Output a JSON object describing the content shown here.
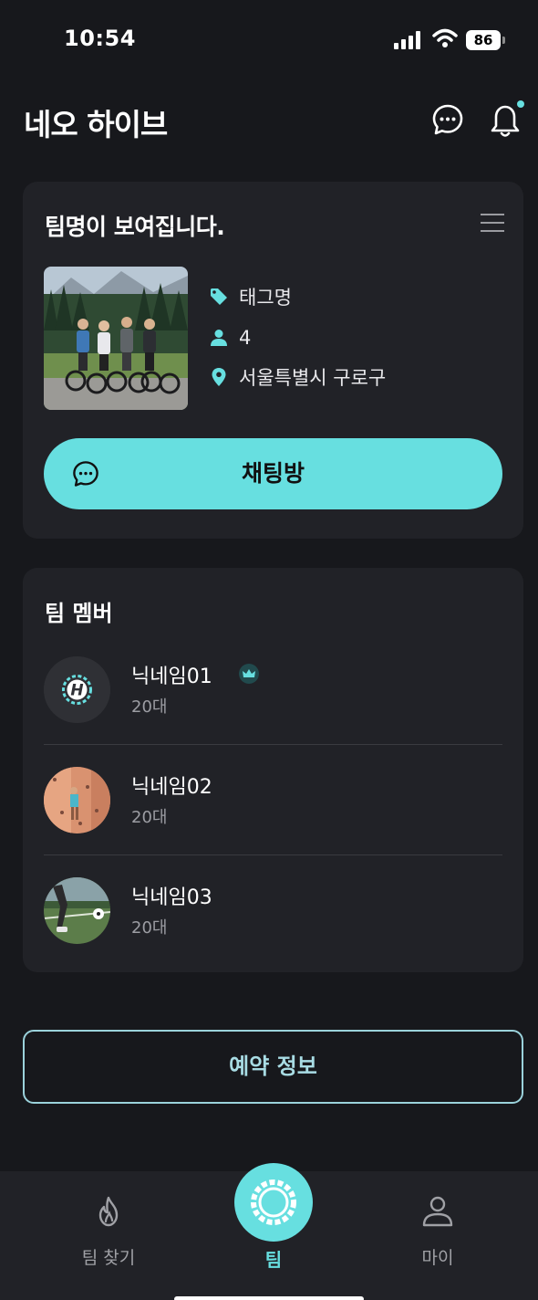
{
  "status_bar": {
    "time": "10:54",
    "battery": "86"
  },
  "header": {
    "title": "네오 하이브",
    "chat_icon": "chat-bubble-icon",
    "bell_icon": "bell-icon"
  },
  "team": {
    "name": "팀명이 보여집니다.",
    "tag": "태그명",
    "member_count": "4",
    "location": "서울특별시 구로구",
    "chat_button": "채팅방"
  },
  "members": {
    "title": "팀 멤버",
    "list": [
      {
        "nickname": "닉네임01",
        "age": "20대",
        "leader": true
      },
      {
        "nickname": "닉네임02",
        "age": "20대",
        "leader": false
      },
      {
        "nickname": "닉네임03",
        "age": "20대",
        "leader": false
      }
    ]
  },
  "reservation_button": "예약 정보",
  "tabbar": {
    "items": [
      {
        "label": "팀 찾기",
        "icon": "flame-icon",
        "active": false
      },
      {
        "label": "팀",
        "icon": "team-sun-icon",
        "active": true
      },
      {
        "label": "마이",
        "icon": "person-icon",
        "active": false
      }
    ]
  },
  "colors": {
    "accent": "#67dfe0",
    "background": "#17181c",
    "card": "#212227"
  }
}
